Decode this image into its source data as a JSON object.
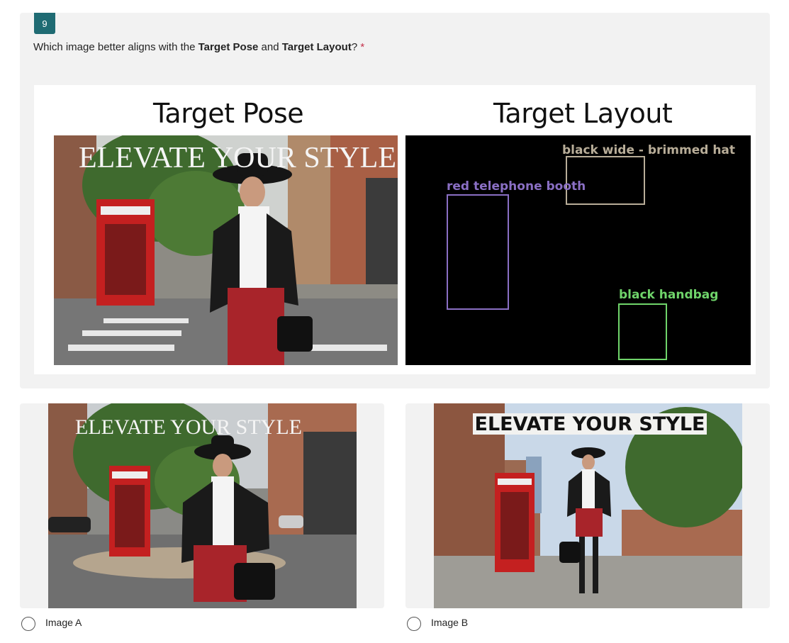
{
  "question": {
    "number": "9",
    "prefix": "Which image better aligns with the ",
    "bold1": "Target Pose",
    "middle": " and ",
    "bold2": "Target Layout",
    "suffix": "?",
    "required_mark": "*"
  },
  "reference": {
    "pose_heading": "Target Pose",
    "layout_heading": "Target Layout",
    "pose_overlay_text": "ELEVATE YOUR STYLE",
    "layout_boxes": [
      {
        "label": "black wide - brimmed hat",
        "color": "#b8ad98"
      },
      {
        "label": "red telephone booth",
        "color": "#8a6fc4"
      },
      {
        "label": "black handbag",
        "color": "#6fd46a"
      }
    ]
  },
  "options": [
    {
      "label": "Image A",
      "overlay_text": "ELEVATE YOUR STYLE"
    },
    {
      "label": "Image B",
      "overlay_text": "ELEVATE YOUR STYLE"
    }
  ],
  "colors": {
    "number_badge": "#1f6b73",
    "required": "#c4314b",
    "card_bg": "#f2f2f2"
  }
}
